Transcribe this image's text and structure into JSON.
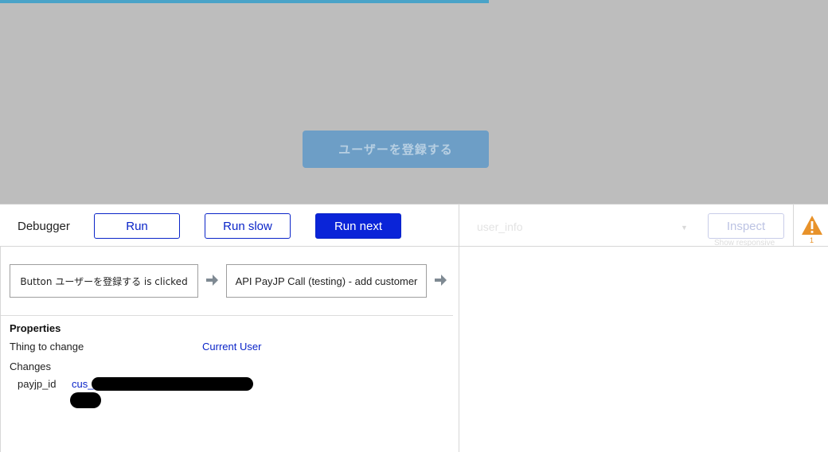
{
  "preview": {
    "progress_percent": 59,
    "register_button_label": "ユーザーを登録する"
  },
  "debugger": {
    "title": "Debugger",
    "run_label": "Run",
    "run_slow_label": "Run slow",
    "run_next_label": "Run next"
  },
  "inspector": {
    "selected_element": "user_info",
    "inspect_label": "Inspect",
    "show_responsive_label": "Show responsive",
    "warning_count": "1"
  },
  "steps": [
    {
      "label": "Button ユーザーを登録する is clicked"
    },
    {
      "label": "API PayJP Call (testing) - add customer"
    }
  ],
  "properties": {
    "title": "Properties",
    "thing_to_change_label": "Thing to change",
    "thing_to_change_value": "Current User",
    "changes_label": "Changes",
    "changes": [
      {
        "field": "payjp_id",
        "value_prefix": "cus_"
      }
    ]
  },
  "colors": {
    "accent": "#0a24c8",
    "preview_overlay": "#bdbdbd",
    "warning": "#e8922a"
  },
  "icons": {
    "arrow": "arrow-right-icon",
    "warning": "warning-triangle-icon",
    "dropdown": "chevron-down-icon"
  }
}
